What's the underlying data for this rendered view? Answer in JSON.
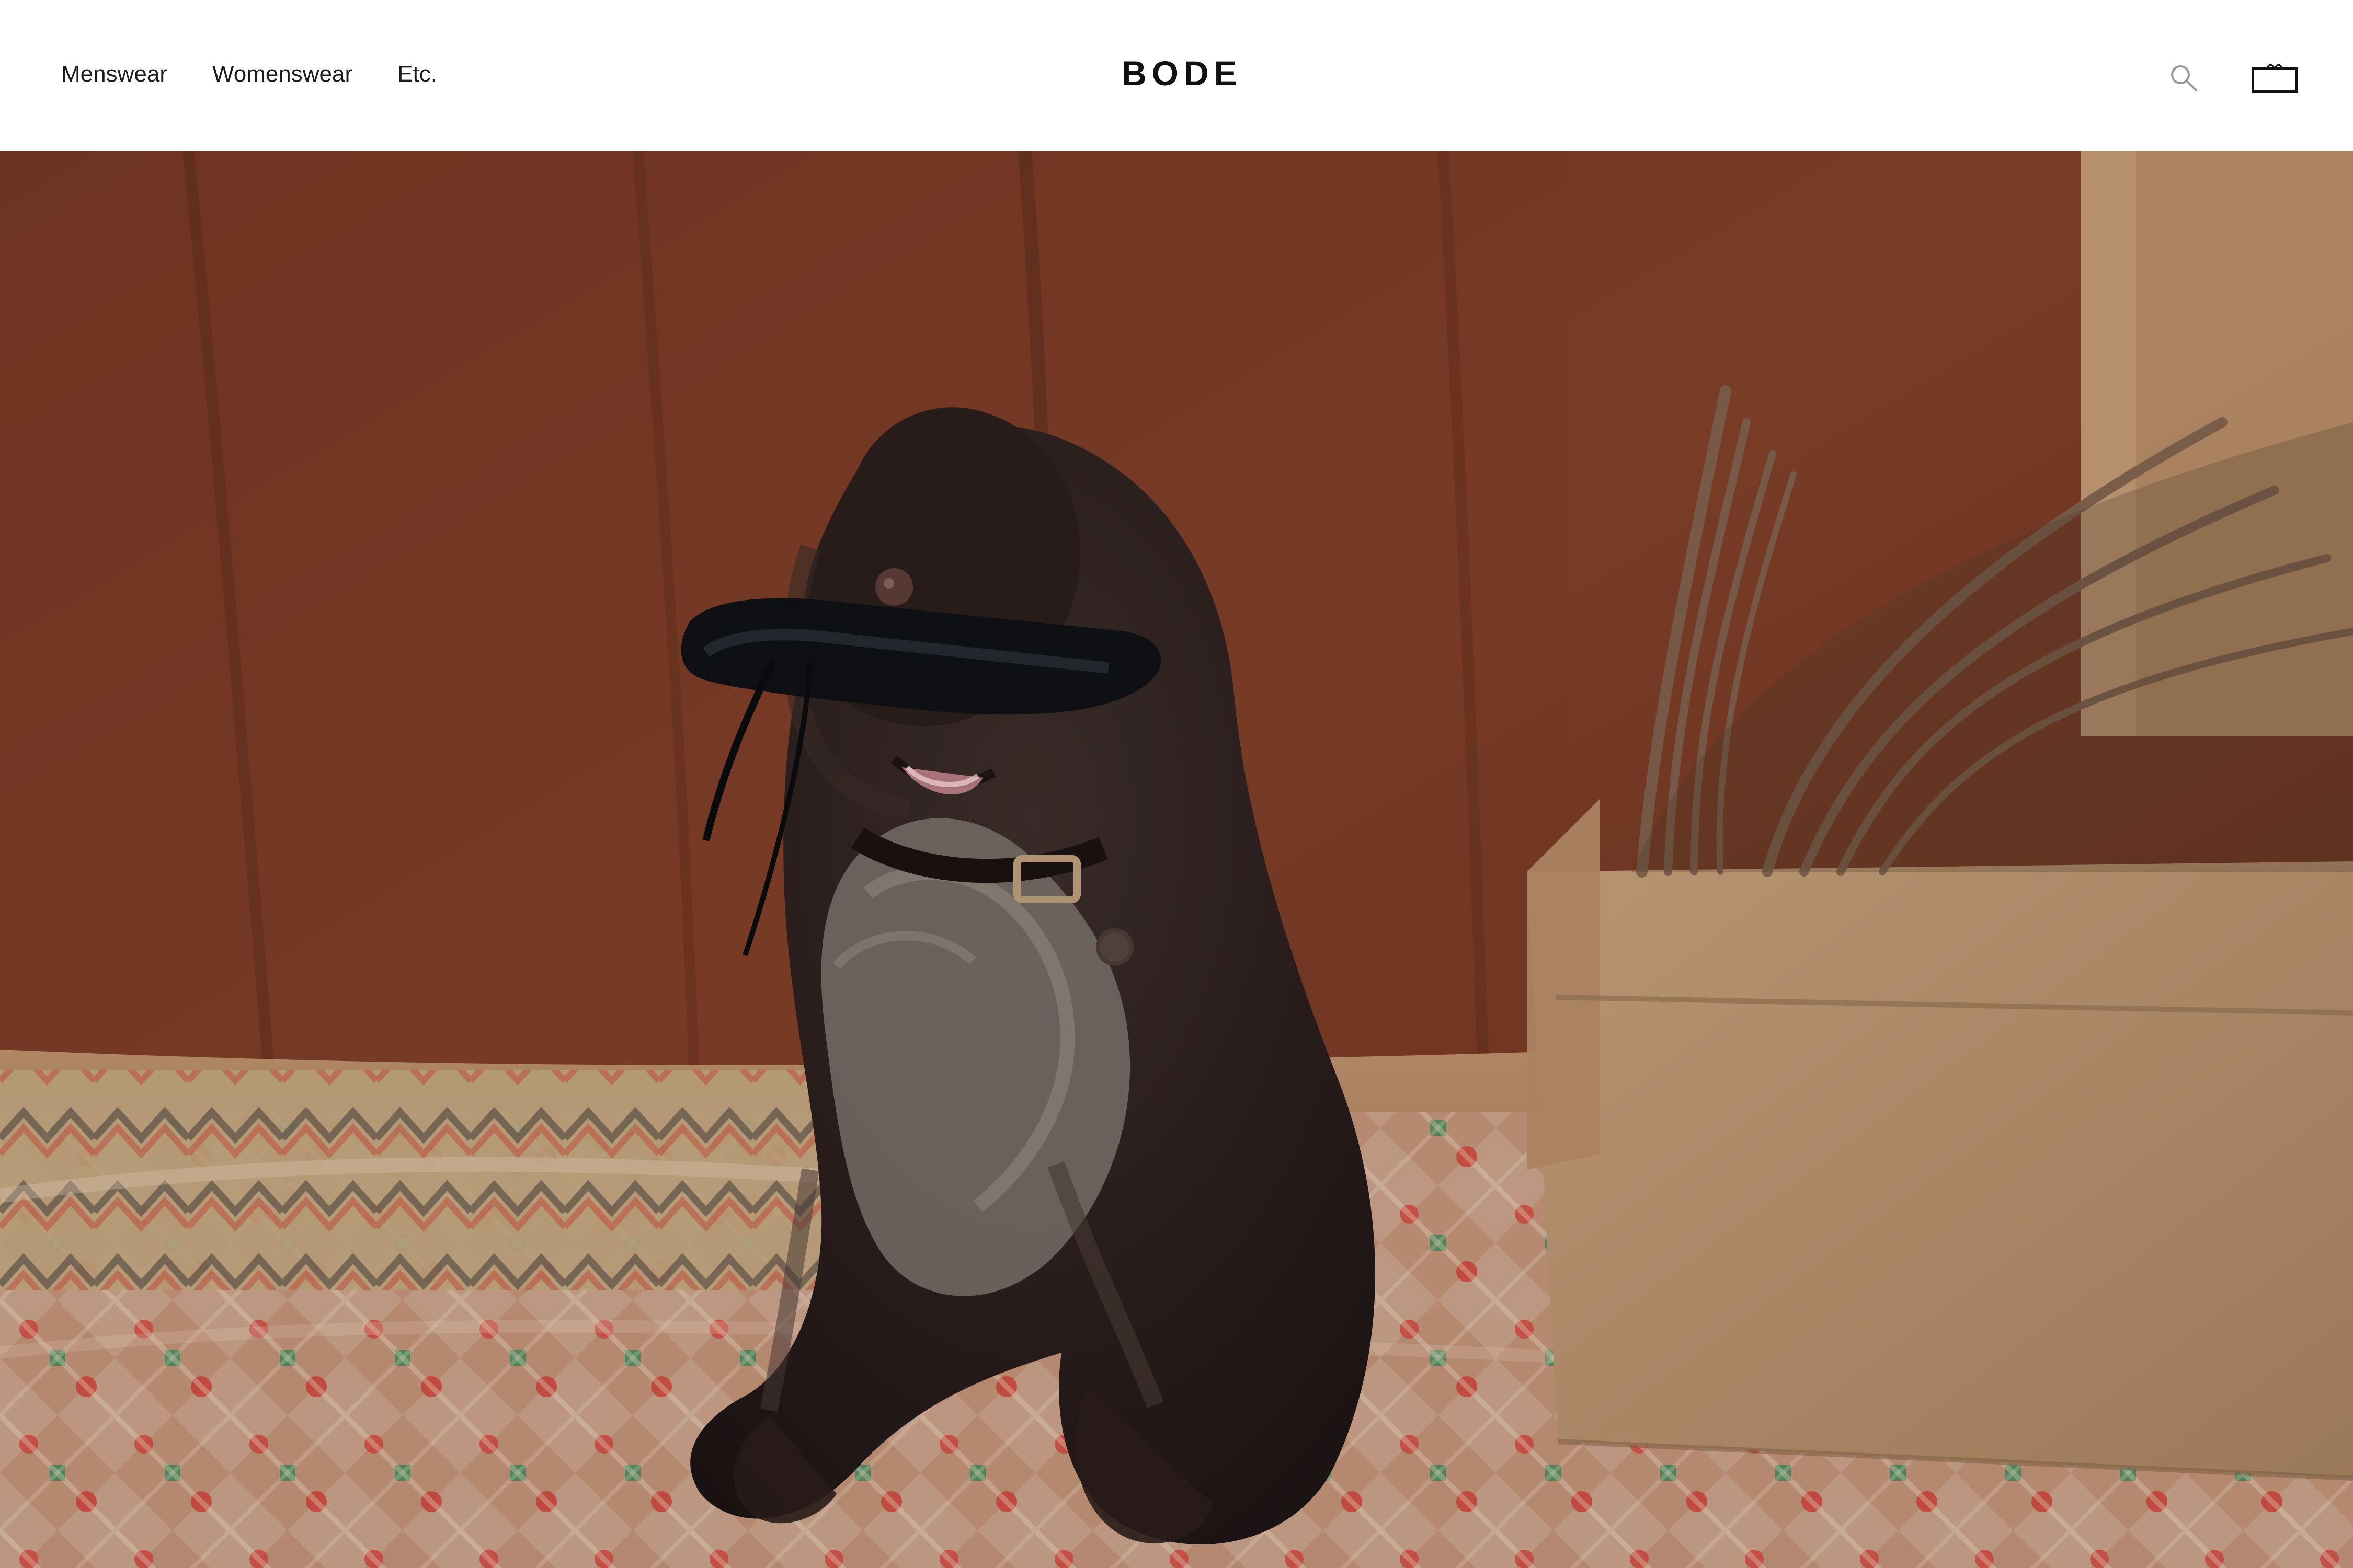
{
  "header": {
    "nav": [
      {
        "label": "Menswear"
      },
      {
        "label": "Womenswear"
      },
      {
        "label": "Etc."
      }
    ],
    "logo": "BODE",
    "icons": {
      "search": "search-icon",
      "cart": "shopping-bag-icon"
    }
  },
  "hero": {
    "image_description_icon": "dog-with-shoe-photo",
    "colors": {
      "backdrop": "#7a3d27",
      "rug": "#caa48a",
      "box": "#b98f67",
      "dog": "#2b1f1d",
      "shoe": "#101114"
    }
  }
}
